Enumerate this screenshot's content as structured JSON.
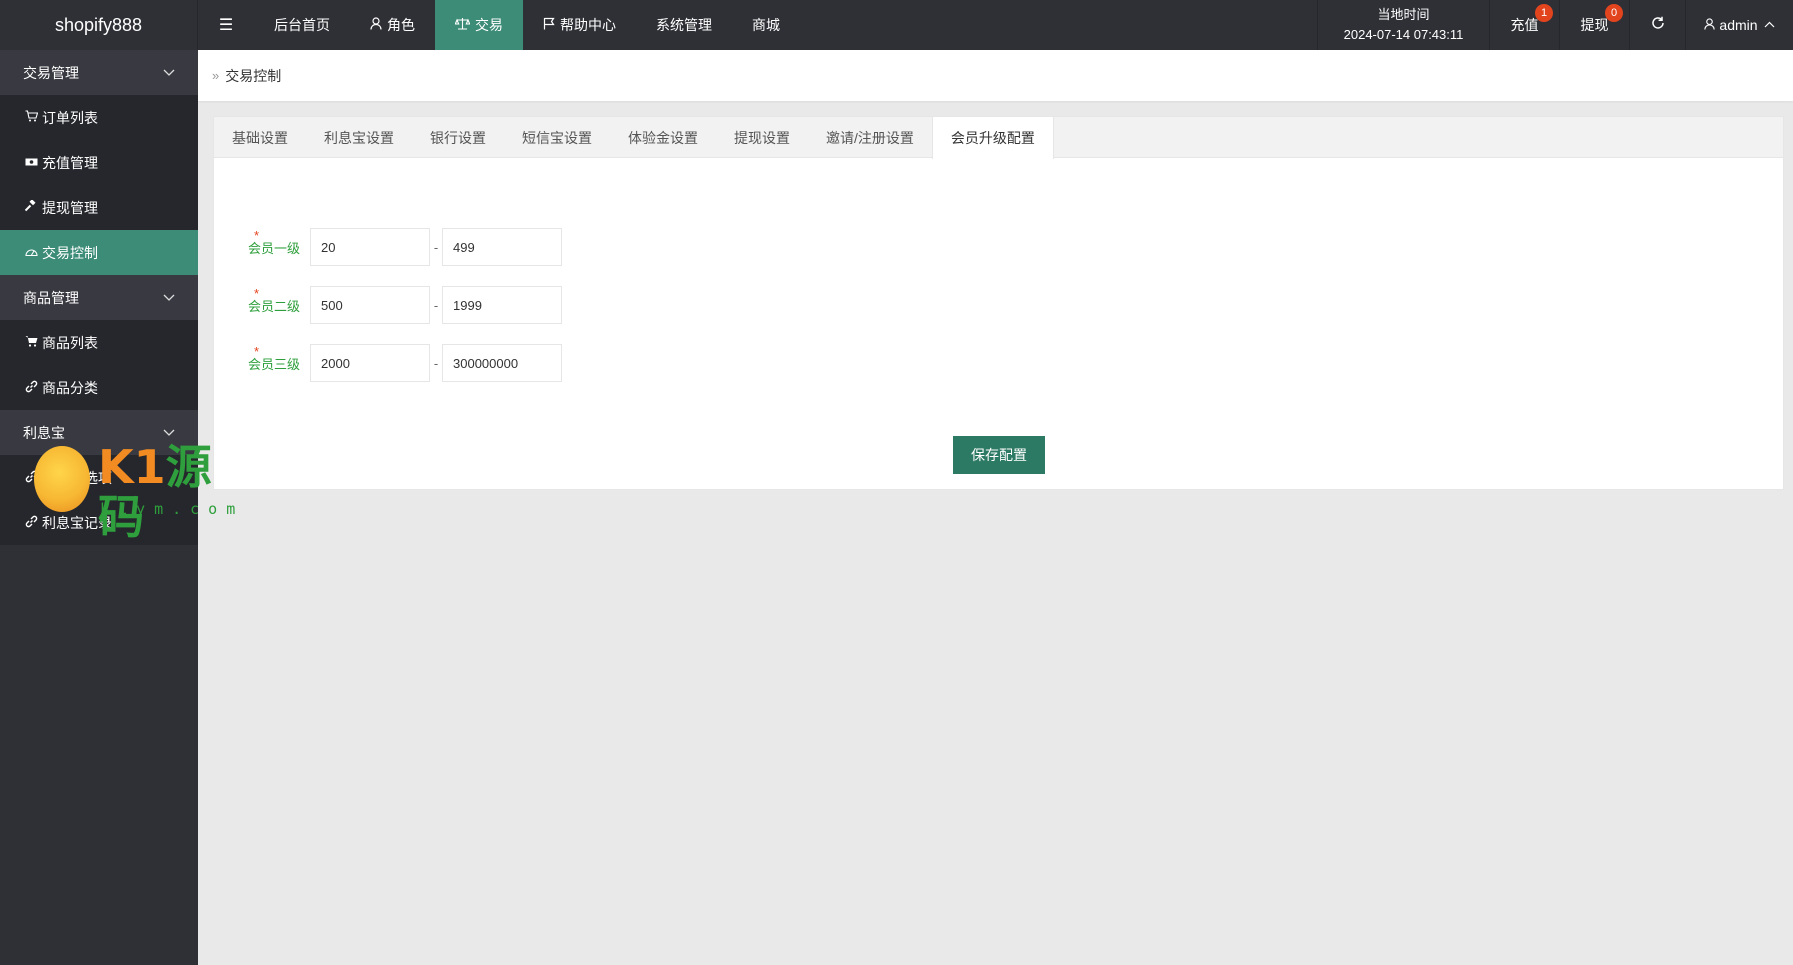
{
  "header": {
    "logo": "shopify888",
    "menu_toggle_icon": "menu-fold-icon",
    "nav": [
      {
        "label": "后台首页",
        "icon": ""
      },
      {
        "label": "角色",
        "icon": "user-icon"
      },
      {
        "label": "交易",
        "icon": "balance-scale-icon"
      },
      {
        "label": "帮助中心",
        "icon": "flag-icon"
      },
      {
        "label": "系统管理",
        "icon": ""
      },
      {
        "label": "商城",
        "icon": ""
      }
    ],
    "clock_label": "当地时间",
    "clock_value": "2024-07-14 07:43:11",
    "recharge_label": "充值",
    "recharge_badge": "1",
    "withdraw_label": "提现",
    "withdraw_badge": "0",
    "user_label": "admin"
  },
  "sidebar": {
    "groups": [
      {
        "label": "交易管理",
        "items": [
          "订单列表",
          "充值管理",
          "提现管理",
          "交易控制"
        ]
      },
      {
        "label": "商品管理",
        "items": [
          "商品列表",
          "商品分类"
        ]
      },
      {
        "label": "利息宝",
        "items": [
          "利息宝选项",
          "利息宝记录"
        ]
      }
    ]
  },
  "breadcrumb": {
    "current": "交易控制"
  },
  "tabs": [
    "基础设置",
    "利息宝设置",
    "银行设置",
    "短信宝设置",
    "体验金设置",
    "提现设置",
    "邀请/注册设置",
    "会员升级配置"
  ],
  "form": {
    "rows": [
      {
        "label": "会员一级",
        "min": "20",
        "max": "499"
      },
      {
        "label": "会员二级",
        "min": "500",
        "max": "1999"
      },
      {
        "label": "会员三级",
        "min": "2000",
        "max": "300000000"
      }
    ],
    "separator": "-",
    "required_mark": "*",
    "save_label": "保存配置"
  },
  "watermark": {
    "brand_k1": "K1",
    "brand_cn": "源码",
    "url": "k1ym.com"
  },
  "colors": {
    "accent": "#3d8c77",
    "dark": "#2f3036",
    "label_green": "#2e9f3c",
    "badge": "#e2441e",
    "button": "#2c7a63"
  }
}
